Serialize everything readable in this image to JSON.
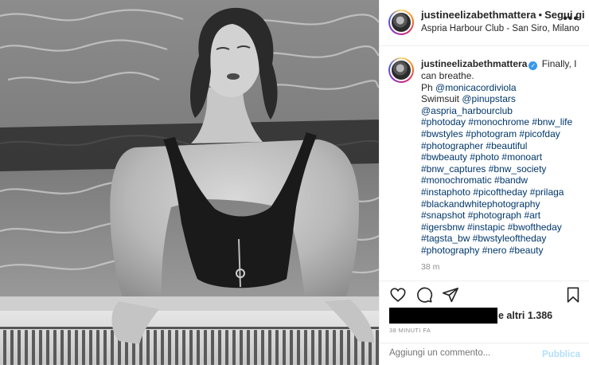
{
  "post": {
    "username": "justineelizabethmattera",
    "separator": "•",
    "follow_label": "Segui già",
    "location": "Aspria Harbour Club - San Siro, Milano",
    "more_icon": "more-horizontal-icon"
  },
  "caption": {
    "username": "justineelizabethmattera",
    "verified_icon": "verified-badge-icon",
    "text": "Finally, I can breathe.",
    "ph_prefix": "Ph ",
    "ph_handle": "@monicacordiviola",
    "swimsuit_prefix": "Swimsuit ",
    "swimsuit_handle": "@pinupstars",
    "location_handle": "@aspria_harbourclub",
    "hashtags": [
      "#photoday #monochrome #bnw_life",
      "#bwstyles #photogram #picofday",
      "#photographer #beautiful",
      "#bwbeauty #photo #monoart",
      "#bnw_captures #bnw_society",
      "#monochromatic #bandw",
      "#instaphoto #picoftheday #prilaga",
      "#blackandwhitephotography",
      "#snapshot #photograph #art",
      "#igersbnw #instapic #bwoftheday",
      "#tagsta_bw #bwstyleoftheday",
      "#photography #nero #beauty"
    ],
    "time": "38 m"
  },
  "actions": {
    "like_icon": "heart-icon",
    "comment_icon": "comment-icon",
    "share_icon": "share-icon",
    "save_icon": "bookmark-icon"
  },
  "likes": {
    "text": "e altri 1.386"
  },
  "timestamp": "38 MINUTI FA",
  "comment": {
    "placeholder": "Aggiungi un commento...",
    "publish_label": "Pubblica"
  },
  "colors": {
    "link": "#00376b",
    "muted": "#8e8e8e",
    "publish_disabled": "#b2dffc",
    "verified": "#3897f0",
    "border": "#efefef"
  }
}
